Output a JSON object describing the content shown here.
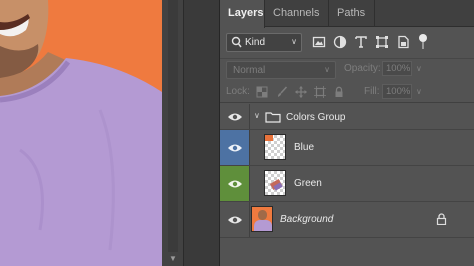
{
  "panel": {
    "tabs": [
      {
        "label": "Layers",
        "active": true
      },
      {
        "label": "Channels",
        "active": false
      },
      {
        "label": "Paths",
        "active": false
      }
    ]
  },
  "filter": {
    "kind_label": "Kind",
    "icons": [
      "image-filter-icon",
      "adjustment-filter-icon",
      "type-filter-icon",
      "shape-filter-icon",
      "smart-object-filter-icon",
      "filter-toggle-icon"
    ]
  },
  "blend": {
    "mode": "Normal",
    "opacity_label": "Opacity:",
    "opacity_value": "100%",
    "lock_label": "Lock:",
    "fill_label": "Fill:",
    "fill_value": "100%",
    "lock_icons": [
      "lock-transparent-icon",
      "lock-brush-icon",
      "lock-move-icon",
      "lock-artboard-icon",
      "lock-all-icon"
    ]
  },
  "layers": [
    {
      "name": "Colors Group",
      "type": "group",
      "visible": true
    },
    {
      "name": "Blue",
      "type": "layer",
      "visible": true,
      "color": "#4d72a3"
    },
    {
      "name": "Green",
      "type": "layer",
      "visible": true,
      "color": "#5f8f3b"
    },
    {
      "name": "Background",
      "type": "background",
      "visible": true,
      "locked": true
    }
  ],
  "colors": {
    "canvas_bg": "#ef7a3f",
    "shirt": "#b49ad3",
    "panel": "#535353"
  }
}
